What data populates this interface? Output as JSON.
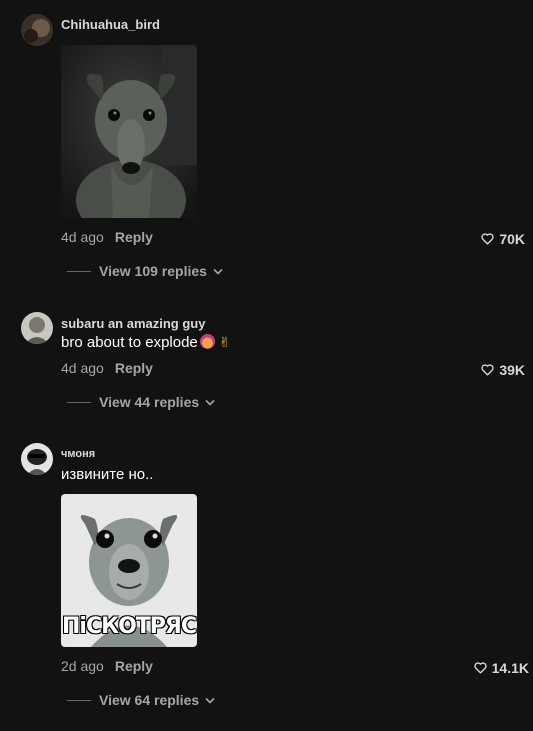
{
  "comments": [
    {
      "username": "Chihuahua_bird",
      "text": "",
      "age": "4d ago",
      "reply_label": "Reply",
      "likes": "70K",
      "view_replies": "View 109 replies"
    },
    {
      "username": "subaru an amazing guy",
      "text": "bro about to explode",
      "age": "4d ago",
      "reply_label": "Reply",
      "likes": "39K",
      "view_replies": "View 44 replies"
    },
    {
      "username": "чмоня",
      "text": "извините но..",
      "age": "2d ago",
      "reply_label": "Reply",
      "likes": "14.1K",
      "view_replies": "View 64 replies",
      "image_caption": "ПіСКОТРЯС"
    }
  ],
  "colors": {
    "background": "#121212",
    "meta_text": "#a6a6a6",
    "username_text": "#d9d9d9"
  }
}
